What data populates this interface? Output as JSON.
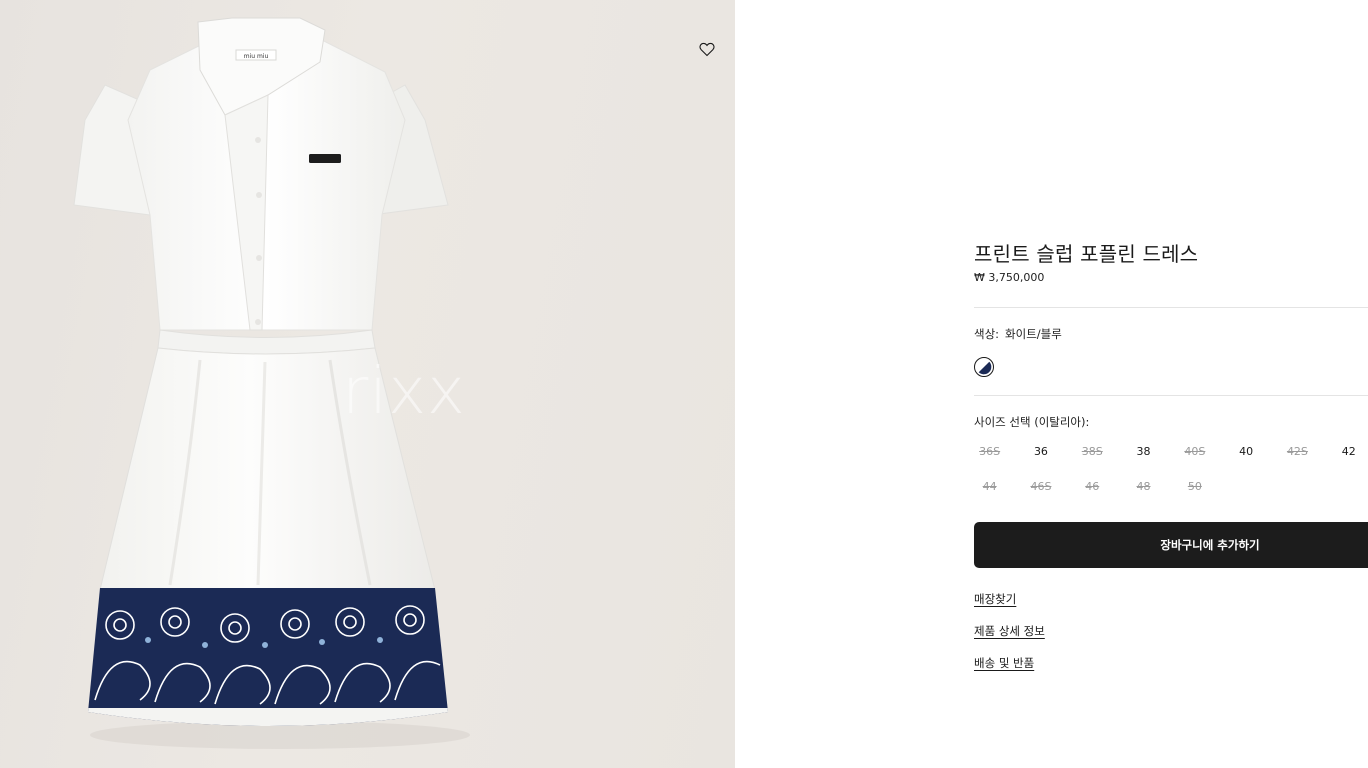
{
  "product": {
    "title": "프린트 슬럽 포플린 드레스",
    "price": "₩ 3,750,000",
    "image_label": "miu miu"
  },
  "watermark": "rixx",
  "color": {
    "label": "색상:",
    "value": "화이트/블루",
    "swatch_colors": [
      "#ffffff",
      "#1b2a55"
    ]
  },
  "size": {
    "label": "사이즈 선택 (이탈리아):",
    "options": [
      {
        "label": "36S",
        "available": false
      },
      {
        "label": "36",
        "available": true
      },
      {
        "label": "38S",
        "available": false
      },
      {
        "label": "38",
        "available": true
      },
      {
        "label": "40S",
        "available": false
      },
      {
        "label": "40",
        "available": true
      },
      {
        "label": "42S",
        "available": false
      },
      {
        "label": "42",
        "available": true
      },
      {
        "label": "44",
        "available": false
      },
      {
        "label": "46S",
        "available": false
      },
      {
        "label": "46",
        "available": false
      },
      {
        "label": "48",
        "available": false
      },
      {
        "label": "50",
        "available": false
      }
    ]
  },
  "actions": {
    "add_to_cart": "장바구니에 추가하기"
  },
  "links": {
    "store_locator": "매장찾기",
    "product_details": "제품 상세 정보",
    "shipping_returns": "배송 및 반품"
  },
  "icons": {
    "wishlist": "heart-icon",
    "swatch": "color-swatch-icon"
  },
  "colors": {
    "button_bg": "#1c1c1c",
    "navy": "#1b2a55",
    "panel_bg": "#e9e5e0"
  }
}
